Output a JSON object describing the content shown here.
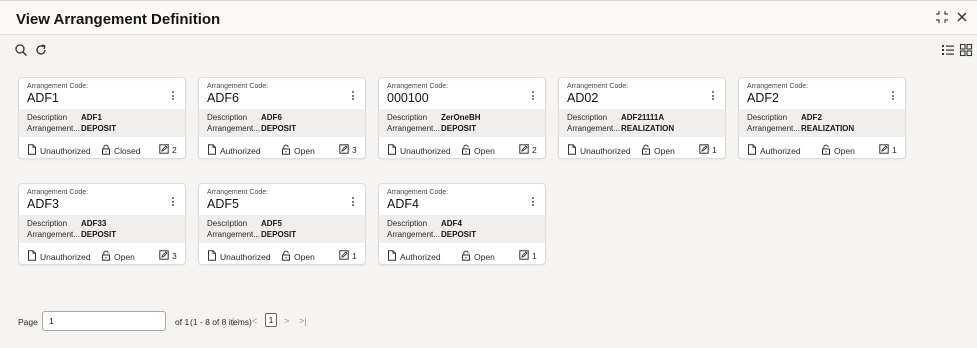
{
  "window": {
    "title": "View Arrangement Definition",
    "restore_glyph": "↗↙",
    "close_glyph": "✕"
  },
  "toolbar": {
    "search_icon": "search-icon",
    "refresh_icon": "refresh-icon",
    "list_view_icon": "list-view-icon",
    "grid_view_icon": "grid-view-icon"
  },
  "card_labels": {
    "code_label": "Arrangement Code:",
    "description_label": "Description",
    "arrangement_label": "Arrangement..."
  },
  "cards": [
    {
      "code": "ADF1",
      "description": "ADF1",
      "arrangement": "DEPOSIT",
      "status": "Unauthorized",
      "lock": "Closed",
      "lock_icon": "lock-closed-icon",
      "edits": "2"
    },
    {
      "code": "ADF6",
      "description": "ADF6",
      "arrangement": "DEPOSIT",
      "status": "Authorized",
      "lock": "Open",
      "lock_icon": "lock-open-icon",
      "edits": "3"
    },
    {
      "code": "000100",
      "description": "ZerOneBH",
      "arrangement": "DEPOSIT",
      "status": "Unauthorized",
      "lock": "Open",
      "lock_icon": "lock-open-icon",
      "edits": "2"
    },
    {
      "code": "AD02",
      "description": "ADF21111A",
      "arrangement": "REALIZATION",
      "status": "Unauthorized",
      "lock": "Open",
      "lock_icon": "lock-open-icon",
      "edits": "1"
    },
    {
      "code": "ADF2",
      "description": "ADF2",
      "arrangement": "REALIZATION",
      "status": "Authorized",
      "lock": "Open",
      "lock_icon": "lock-open-icon",
      "edits": "1"
    },
    {
      "code": "ADF3",
      "description": "ADF33",
      "arrangement": "DEPOSIT",
      "status": "Unauthorized",
      "lock": "Open",
      "lock_icon": "lock-open-icon",
      "edits": "3"
    },
    {
      "code": "ADF5",
      "description": "ADF5",
      "arrangement": "DEPOSIT",
      "status": "Unauthorized",
      "lock": "Open",
      "lock_icon": "lock-open-icon",
      "edits": "1"
    },
    {
      "code": "ADF4",
      "description": "ADF4",
      "arrangement": "DEPOSIT",
      "status": "Authorized",
      "lock": "Open",
      "lock_icon": "lock-open-icon",
      "edits": "1"
    }
  ],
  "pagination": {
    "page_label": "Page",
    "page_value": "1",
    "of_label": "of 1",
    "items_label": "(1 - 8 of 8 items)",
    "first_glyph": "|<",
    "prev_glyph": "<",
    "current_page": "1",
    "next_glyph": ">",
    "last_glyph": ">|"
  },
  "colors": {
    "background": "#f6f4f2",
    "card": "#ffffff",
    "card_body": "#f1efed",
    "text": "#161513"
  }
}
